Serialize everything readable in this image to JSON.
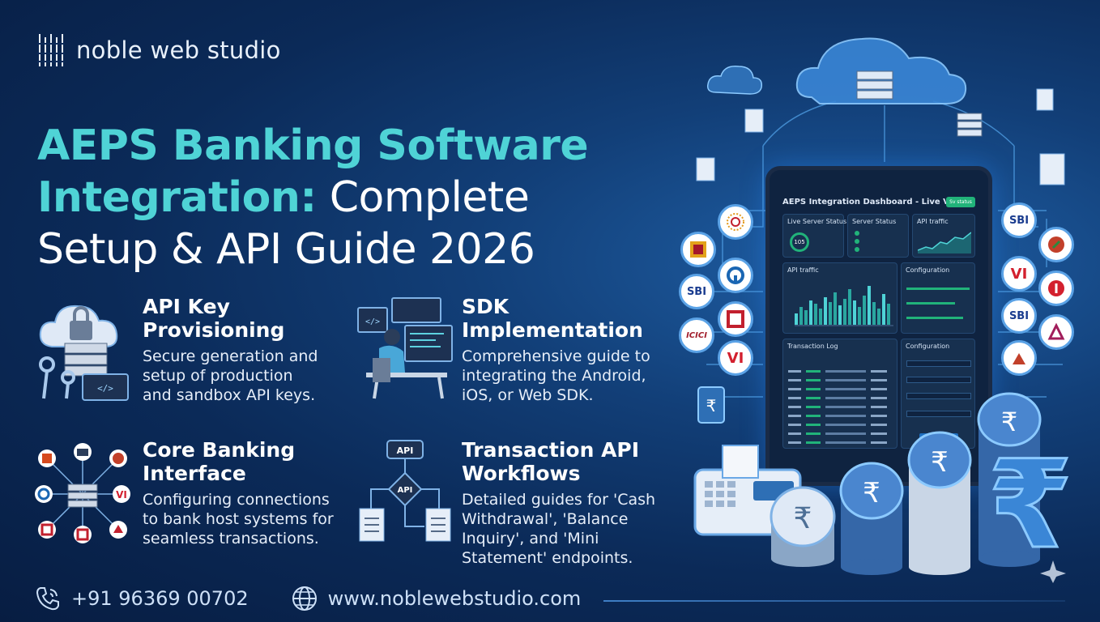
{
  "brand": {
    "name": "noble web studio"
  },
  "headline": {
    "line1": "AEPS Banking Software",
    "line2_accent": "Integration:",
    "line2_rest": " Complete",
    "line3": "Setup & API Guide 2026"
  },
  "features": [
    {
      "title_l1": "API Key",
      "title_l2": "Provisioning",
      "desc_l1": "Secure generation and",
      "desc_l2": "setup of production",
      "desc_l3": "and sandbox API keys.",
      "desc_l4": ""
    },
    {
      "title_l1": "SDK",
      "title_l2": "Implementation",
      "desc_l1": "Comprehensive guide to",
      "desc_l2": "integrating the Android,",
      "desc_l3": "iOS, or Web SDK.",
      "desc_l4": ""
    },
    {
      "title_l1": "Core Banking",
      "title_l2": "Interface",
      "desc_l1": "Configuring connections",
      "desc_l2": "to bank host systems for",
      "desc_l3": "seamless transactions.",
      "desc_l4": ""
    },
    {
      "title_l1": "Transaction API",
      "title_l2": "Workflows",
      "desc_l1": "Detailed guides for 'Cash",
      "desc_l2": "Withdrawal', 'Balance",
      "desc_l3": "Inquiry', and 'Mini",
      "desc_l4": "Statement' endpoints."
    }
  ],
  "icon_labels": {
    "api": "API"
  },
  "footer": {
    "phone": "+91 96369 00702",
    "website": "www.noblewebstudio.com"
  },
  "dashboard": {
    "title": "AEPS Integration Dashboard - Live View",
    "button": "Sv status",
    "server_status": "Live Server Status",
    "server_value": "105",
    "server_status2": "Server Status",
    "api_traffic": "API traffic",
    "api_traffic2": "API traffic",
    "configuration": "Configuration",
    "configuration2": "Configuration",
    "transaction_log": "Transaction Log"
  },
  "bank_logos": {
    "sbi": "SBI",
    "vi": "VI",
    "icici": "ICICI"
  },
  "colors": {
    "accent": "#4fd3d6",
    "background": "#0b2a58",
    "panel": "#17304f",
    "green": "#21b37a"
  }
}
